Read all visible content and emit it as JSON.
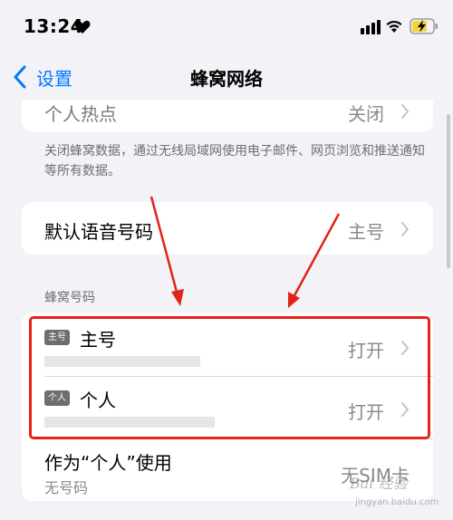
{
  "status_bar": {
    "time": "13:24"
  },
  "nav": {
    "back_label": "设置",
    "title": "蜂窝网络"
  },
  "hotspot": {
    "title": "个人热点",
    "value": "关闭"
  },
  "footer_note": "关闭蜂窝数据，通过无线局域网使用电子邮件、网页浏览和推送通知等所有数据。",
  "default_voice": {
    "title": "默认语音号码",
    "value": "主号"
  },
  "section_header": "蜂窝号码",
  "lines": [
    {
      "tag": "主号",
      "title": "主号",
      "value": "打开"
    },
    {
      "tag": "个人",
      "title": "个人",
      "value": "打开"
    }
  ],
  "use_as": {
    "title": "作为“个人”使用",
    "subtitle": "无号码",
    "value": "无SIM卡"
  },
  "watermark": {
    "text": "Bai 经验",
    "url": "jingyan.baidu.com"
  },
  "colors": {
    "accent": "#007aff",
    "annotation": "#e2231a",
    "battery_fill": "#f5d33d"
  }
}
